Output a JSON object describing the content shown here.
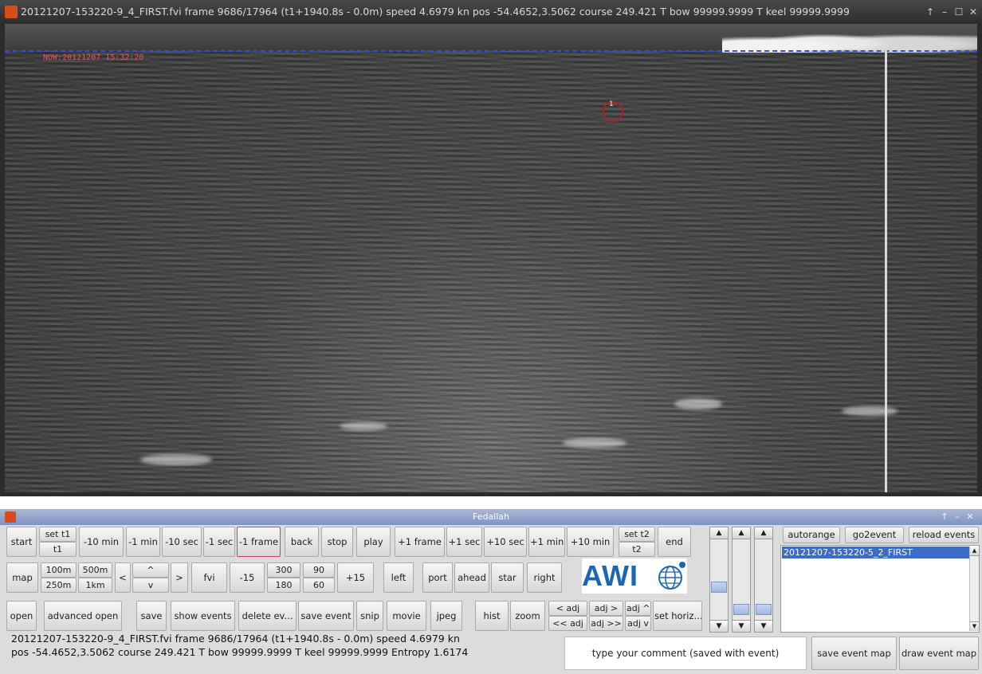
{
  "viewer": {
    "title": "20121207-153220-9_4_FIRST.fvi frame 9686/17964 (t1+1940.8s - 0.0m)  speed 4.6979  kn   pos -54.4652,3.5062 course 249.421 T bow 99999.9999 T keel 99999.9999",
    "window_controls": {
      "up": "↑",
      "minimize": "–",
      "maximize": "☐",
      "close": "✕"
    },
    "now_stamp": "NOW:20121207 15:32:20",
    "target_label": "1"
  },
  "control": {
    "title": "Fedallah",
    "window_controls": {
      "up": "↑",
      "minimize": "–",
      "close": "✕"
    },
    "row1": {
      "start": "start",
      "set_t1": "set t1",
      "t1": "t1",
      "minus_10min": "-10 min",
      "minus_1min": "-1 min",
      "minus_10sec": "-10 sec",
      "minus_1sec": "-1 sec",
      "minus_1frame": "-1 frame",
      "back": "back",
      "stop": "stop",
      "play": "play",
      "plus_1frame": "+1 frame",
      "plus_1sec": "+1 sec",
      "plus_10sec": "+10 sec",
      "plus_1min": "+1 min",
      "plus_10min": "+10 min",
      "set_t2": "set t2",
      "t2": "t2",
      "end": "end"
    },
    "row2": {
      "map": "map",
      "m100": "100m",
      "m500": "500m",
      "m250": "250m",
      "km1": "1km",
      "lt": "<",
      "up": "^",
      "down": "v",
      "gt": ">",
      "fvi": "fvi",
      "minus15": "-15",
      "v300": "300",
      "v180": "180",
      "v90": "90",
      "v60": "60",
      "plus15": "+15",
      "left": "left",
      "port": "port",
      "ahead": "ahead",
      "star": "star",
      "right": "right"
    },
    "row3": {
      "open": "open",
      "advanced_open": "advanced open",
      "save": "save",
      "show_events": "show events",
      "delete_events": "delete ev...",
      "save_event": "save event",
      "snip": "snip",
      "movie": "movie",
      "jpeg": "jpeg",
      "hist": "hist",
      "zoom": "zoom",
      "adj_left": "< adj",
      "adj_right": "adj >",
      "adj_up": "adj ^",
      "adj_far_left": "<< adj",
      "adj_far_right": "adj >>",
      "adj_down": "adj v",
      "set_horizon": "set horiz..."
    },
    "logo_text": "AWI",
    "status_line1": "20121207-153220-9_4_FIRST.fvi frame 9686/17964 (t1+1940.8s - 0.0m)  speed 4.6979  kn",
    "status_line2": "pos -54.4652,3.5062 course 249.421 T bow 99999.9999 T keel 99999.9999 Entropy 1.6174",
    "comment_placeholder": "type your comment (saved with event)",
    "right_panel": {
      "autorange": "autorange",
      "go2event": "go2event",
      "reload_events": "reload events",
      "events": [
        "20121207-153220-5_2_FIRST"
      ],
      "save_event_map": "save event map",
      "draw_event_map": "draw event map"
    },
    "scroll_arrows": {
      "up": "▲",
      "down": "▼"
    }
  },
  "colors": {
    "accent": "#3b6cc6",
    "horizon": "#3a4fd0",
    "target": "#b02020",
    "awi_blue": "#1d66b4"
  }
}
